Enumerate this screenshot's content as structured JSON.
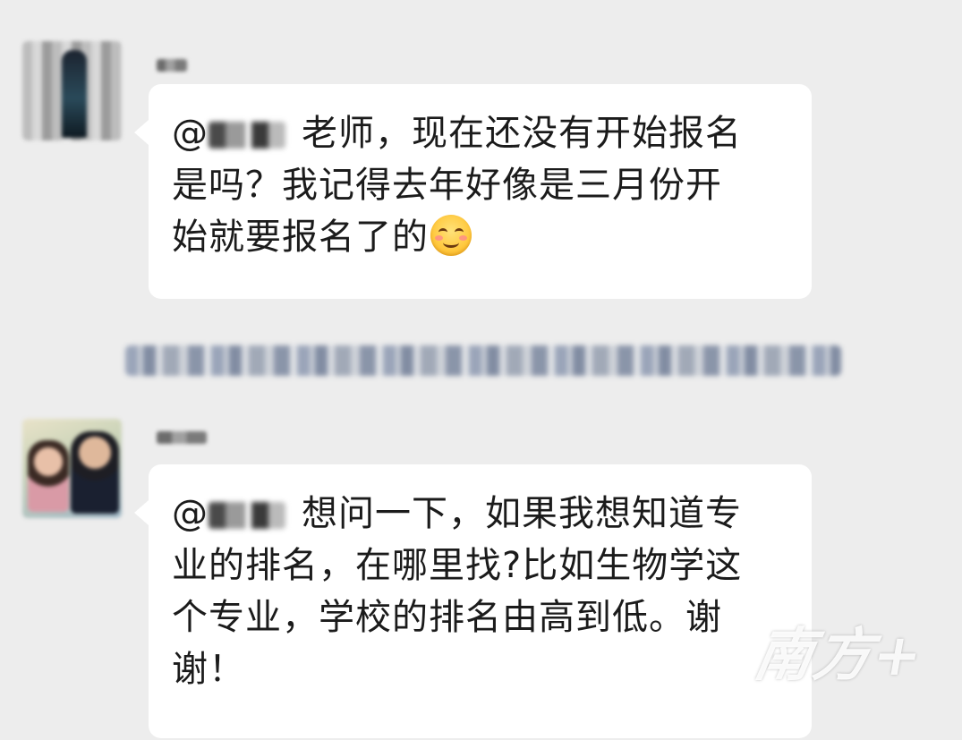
{
  "messages": [
    {
      "mention_prefix": "@",
      "text_line_1": "老师，现在还没有开始报名",
      "text_line_2": "是吗？我记得去年好像是三月份开",
      "text_line_3": "始就要报名了的",
      "emoji": "smiling-face-emoji"
    },
    {
      "mention_prefix": "@",
      "text_line_1": "想问一下，如果我想知道专",
      "text_line_2": "业的排名，在哪里找?比如生物学这",
      "text_line_3": "个专业，学校的排名由高到低。谢",
      "text_line_4": "谢！"
    }
  ],
  "watermark": "南方+",
  "colors": {
    "background": "#ededed",
    "bubble": "#ffffff",
    "text": "#1b1b1b"
  }
}
